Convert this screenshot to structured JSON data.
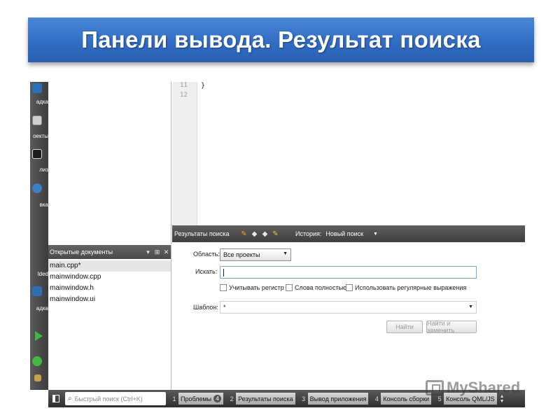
{
  "slide": {
    "title": "Панели вывода. Результат поиска"
  },
  "mode_bar": {
    "items": [
      {
        "label": "адка",
        "icon": "debug-icon"
      },
      {
        "label": "оекты",
        "icon": "projects-icon"
      },
      {
        "label": "лиз",
        "icon": "analyze-icon"
      },
      {
        "label": "вка",
        "icon": "help-icon"
      },
      {
        "label": "lded",
        "icon": "build-target-icon"
      },
      {
        "label": "адка",
        "icon": "debug-run-icon"
      }
    ]
  },
  "editor": {
    "line_numbers": [
      "11",
      "12"
    ],
    "code_line": "}"
  },
  "documents": {
    "title": "Открытые документы",
    "items": [
      "main.cpp*",
      "mainwindow.cpp",
      "mainwindow.h",
      "mainwindow.ui"
    ]
  },
  "search_panel": {
    "title": "Результаты поиска",
    "history_label": "История:",
    "history_value": "Новый поиск",
    "scope_label": "Область:",
    "scope_value": "Все проекты",
    "find_label": "Искать:",
    "find_value": "",
    "case_label": "Учитывать регистр",
    "whole_words_label": "Слова полностью",
    "regex_label": "Использовать регулярные выражения",
    "pattern_label": "Шаблон:",
    "pattern_value": "*",
    "find_button": "Найти",
    "replace_button": "Найти и заменить"
  },
  "status_bar": {
    "quick_search_placeholder": "Быстрый поиск (Ctrl+K)",
    "tabs": [
      {
        "num": "1",
        "label": "Проблемы",
        "badge": "4"
      },
      {
        "num": "2",
        "label": "Результаты поиска"
      },
      {
        "num": "3",
        "label": "Вывод приложения"
      },
      {
        "num": "4",
        "label": "Консоль сборки"
      },
      {
        "num": "5",
        "label": "Консоль QML/JS"
      }
    ]
  },
  "watermark": {
    "text": "MyShared"
  },
  "colors": {
    "banner": "#2f6bc2",
    "panel_dark": "#4a4a4a",
    "input_focus": "#7aa7d9"
  }
}
